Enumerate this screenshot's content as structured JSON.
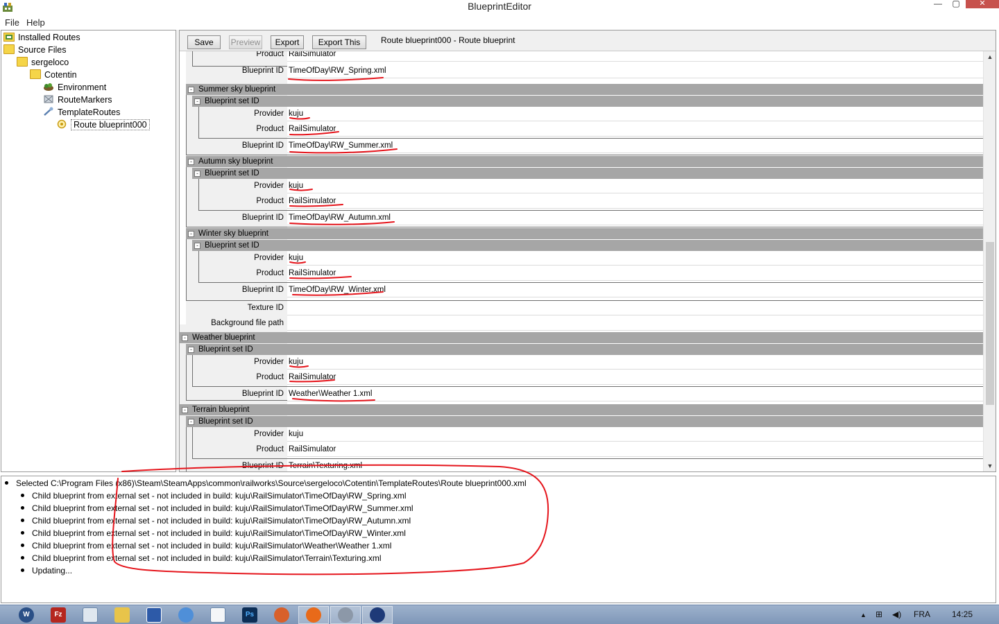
{
  "window": {
    "title": "BlueprintEditor",
    "minimize": "—",
    "maximize": "▢",
    "close": "✕"
  },
  "menu": {
    "file": "File",
    "help": "Help"
  },
  "tree": {
    "installed_routes": "Installed Routes",
    "source_files": "Source Files",
    "sergeloco": "sergeloco",
    "cotentin": "Cotentin",
    "environment": "Environment",
    "route_markers": "RouteMarkers",
    "template_routes": "TemplateRoutes",
    "route_blueprint": "Route blueprint000"
  },
  "toolbar": {
    "save": "Save",
    "preview": "Preview",
    "export": "Export",
    "export_this": "Export This",
    "route_title": "Route blueprint000 - Route blueprint"
  },
  "props": {
    "top_product_label": "Product",
    "top_product_value": "RailSimulator",
    "top_bpid_label": "Blueprint ID",
    "top_bpid_value": "TimeOfDay\\RW_Spring.xml",
    "summer": {
      "title": "Summer sky blueprint",
      "set": "Blueprint set ID",
      "provider_label": "Provider",
      "provider": "kuju",
      "product_label": "Product",
      "product": "RailSimulator",
      "bpid_label": "Blueprint ID",
      "bpid": "TimeOfDay\\RW_Summer.xml"
    },
    "autumn": {
      "title": "Autumn sky blueprint",
      "set": "Blueprint set ID",
      "provider_label": "Provider",
      "provider": "kuju",
      "product_label": "Product",
      "product": "RailSimulator",
      "bpid_label": "Blueprint ID",
      "bpid": "TimeOfDay\\RW_Autumn.xml"
    },
    "winter": {
      "title": "Winter sky blueprint",
      "set": "Blueprint set ID",
      "provider_label": "Provider",
      "provider": "kuju",
      "product_label": "Product",
      "product": "RailSimulator",
      "bpid_label": "Blueprint ID",
      "bpid": "TimeOfDay\\RW_Winter.xml"
    },
    "texture_id_label": "Texture ID",
    "texture_id_value": "",
    "bg_path_label": "Background file path",
    "bg_path_value": "",
    "weather": {
      "title": "Weather blueprint",
      "set": "Blueprint set ID",
      "provider_label": "Provider",
      "provider": "kuju",
      "product_label": "Product",
      "product": "RailSimulator",
      "bpid_label": "Blueprint ID",
      "bpid": "Weather\\Weather 1.xml"
    },
    "terrain": {
      "title": "Terrain blueprint",
      "set": "Blueprint set ID",
      "provider_label": "Provider",
      "provider": "kuju",
      "product_label": "Product",
      "product": "RailSimulator",
      "bpid_label": "Blueprint ID",
      "bpid": "Terrain\\Texturing.xml"
    },
    "toggle": "-"
  },
  "log": [
    "Selected C:\\Program Files (x86)\\Steam\\SteamApps\\common\\railworks\\Source\\sergeloco\\Cotentin\\TemplateRoutes\\Route blueprint000.xml",
    "Child blueprint from external set - not included in build: kuju\\RailSimulator\\TimeOfDay\\RW_Spring.xml",
    "Child blueprint from external set - not included in build: kuju\\RailSimulator\\TimeOfDay\\RW_Summer.xml",
    "Child blueprint from external set - not included in build: kuju\\RailSimulator\\TimeOfDay\\RW_Autumn.xml",
    "Child blueprint from external set - not included in build: kuju\\RailSimulator\\TimeOfDay\\RW_Winter.xml",
    "Child blueprint from external set - not included in build: kuju\\RailSimulator\\Weather\\Weather 1.xml",
    "Child blueprint from external set - not included in build: kuju\\RailSimulator\\Terrain\\Texturing.xml",
    "Updating..."
  ],
  "taskbar": {
    "icons": [
      "wordpress-icon",
      "filezilla-icon",
      "notepad-icon",
      "explorer-icon",
      "app-icon",
      "chat-icon",
      "document-icon",
      "photoshop-icon",
      "tool-icon",
      "firefox-icon",
      "railworks-icon",
      "blueprint-editor-icon"
    ],
    "photoshop_text": "Ps",
    "filezilla_text": "Fz",
    "language": "FRA",
    "clock": "14:25",
    "tray_up": "▲",
    "tray_net": "⊞",
    "tray_vol": "◀)"
  },
  "colors": {
    "section_bg": "#a6a6a6",
    "markup_red": "#e5141b",
    "taskbar": "#8ca3c2"
  }
}
